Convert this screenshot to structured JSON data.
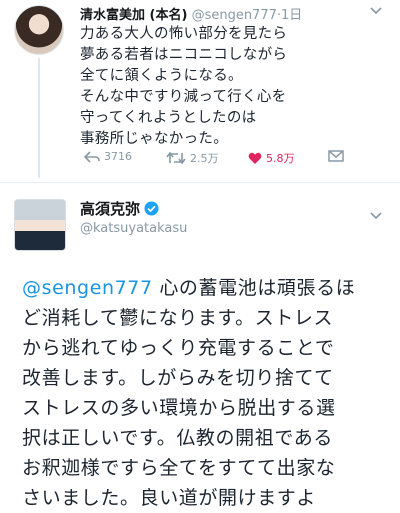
{
  "tweet1": {
    "name": "清水富美加 (本名)",
    "handle": "@sengen777",
    "separator": "·",
    "time": "1日",
    "lines": [
      "力ある大人の怖い部分を見たら",
      "夢ある若者はニコニコしながら",
      "全てに頷くようになる。",
      "そんな中ですり減って行く心を",
      "守ってくれようとしたのは",
      "事務所じゃなかった。"
    ],
    "reply_count": "3716",
    "retweet_count": "2.5万",
    "like_count": "5.8万",
    "icons": [
      "reply-icon",
      "retweet-icon",
      "heart-icon",
      "message-icon",
      "chevron-down-icon"
    ]
  },
  "tweet2": {
    "name": "高須克弥",
    "handle": "@katsuyatakasu",
    "mention": "@sengen777",
    "first_line_rest": " 心の蓄電池は頑張るほ",
    "lines": [
      "ど消耗して鬱になります。ストレス",
      "から逃れてゆっくり充電することで",
      "改善します。しがらみを切り捨てて",
      "ストレスの多い環境から脱出する選",
      "択は正しいです。仏教の開祖である",
      "お釈迦様ですら全てをすてて出家な",
      "さいました。良い道が開けますよ"
    ],
    "icons": [
      "verified-badge-icon",
      "chevron-down-icon"
    ]
  },
  "colors": {
    "like": "#e0245e",
    "link": "#1b95e0",
    "muted": "#8899a6",
    "verified": "#1da1f2"
  }
}
